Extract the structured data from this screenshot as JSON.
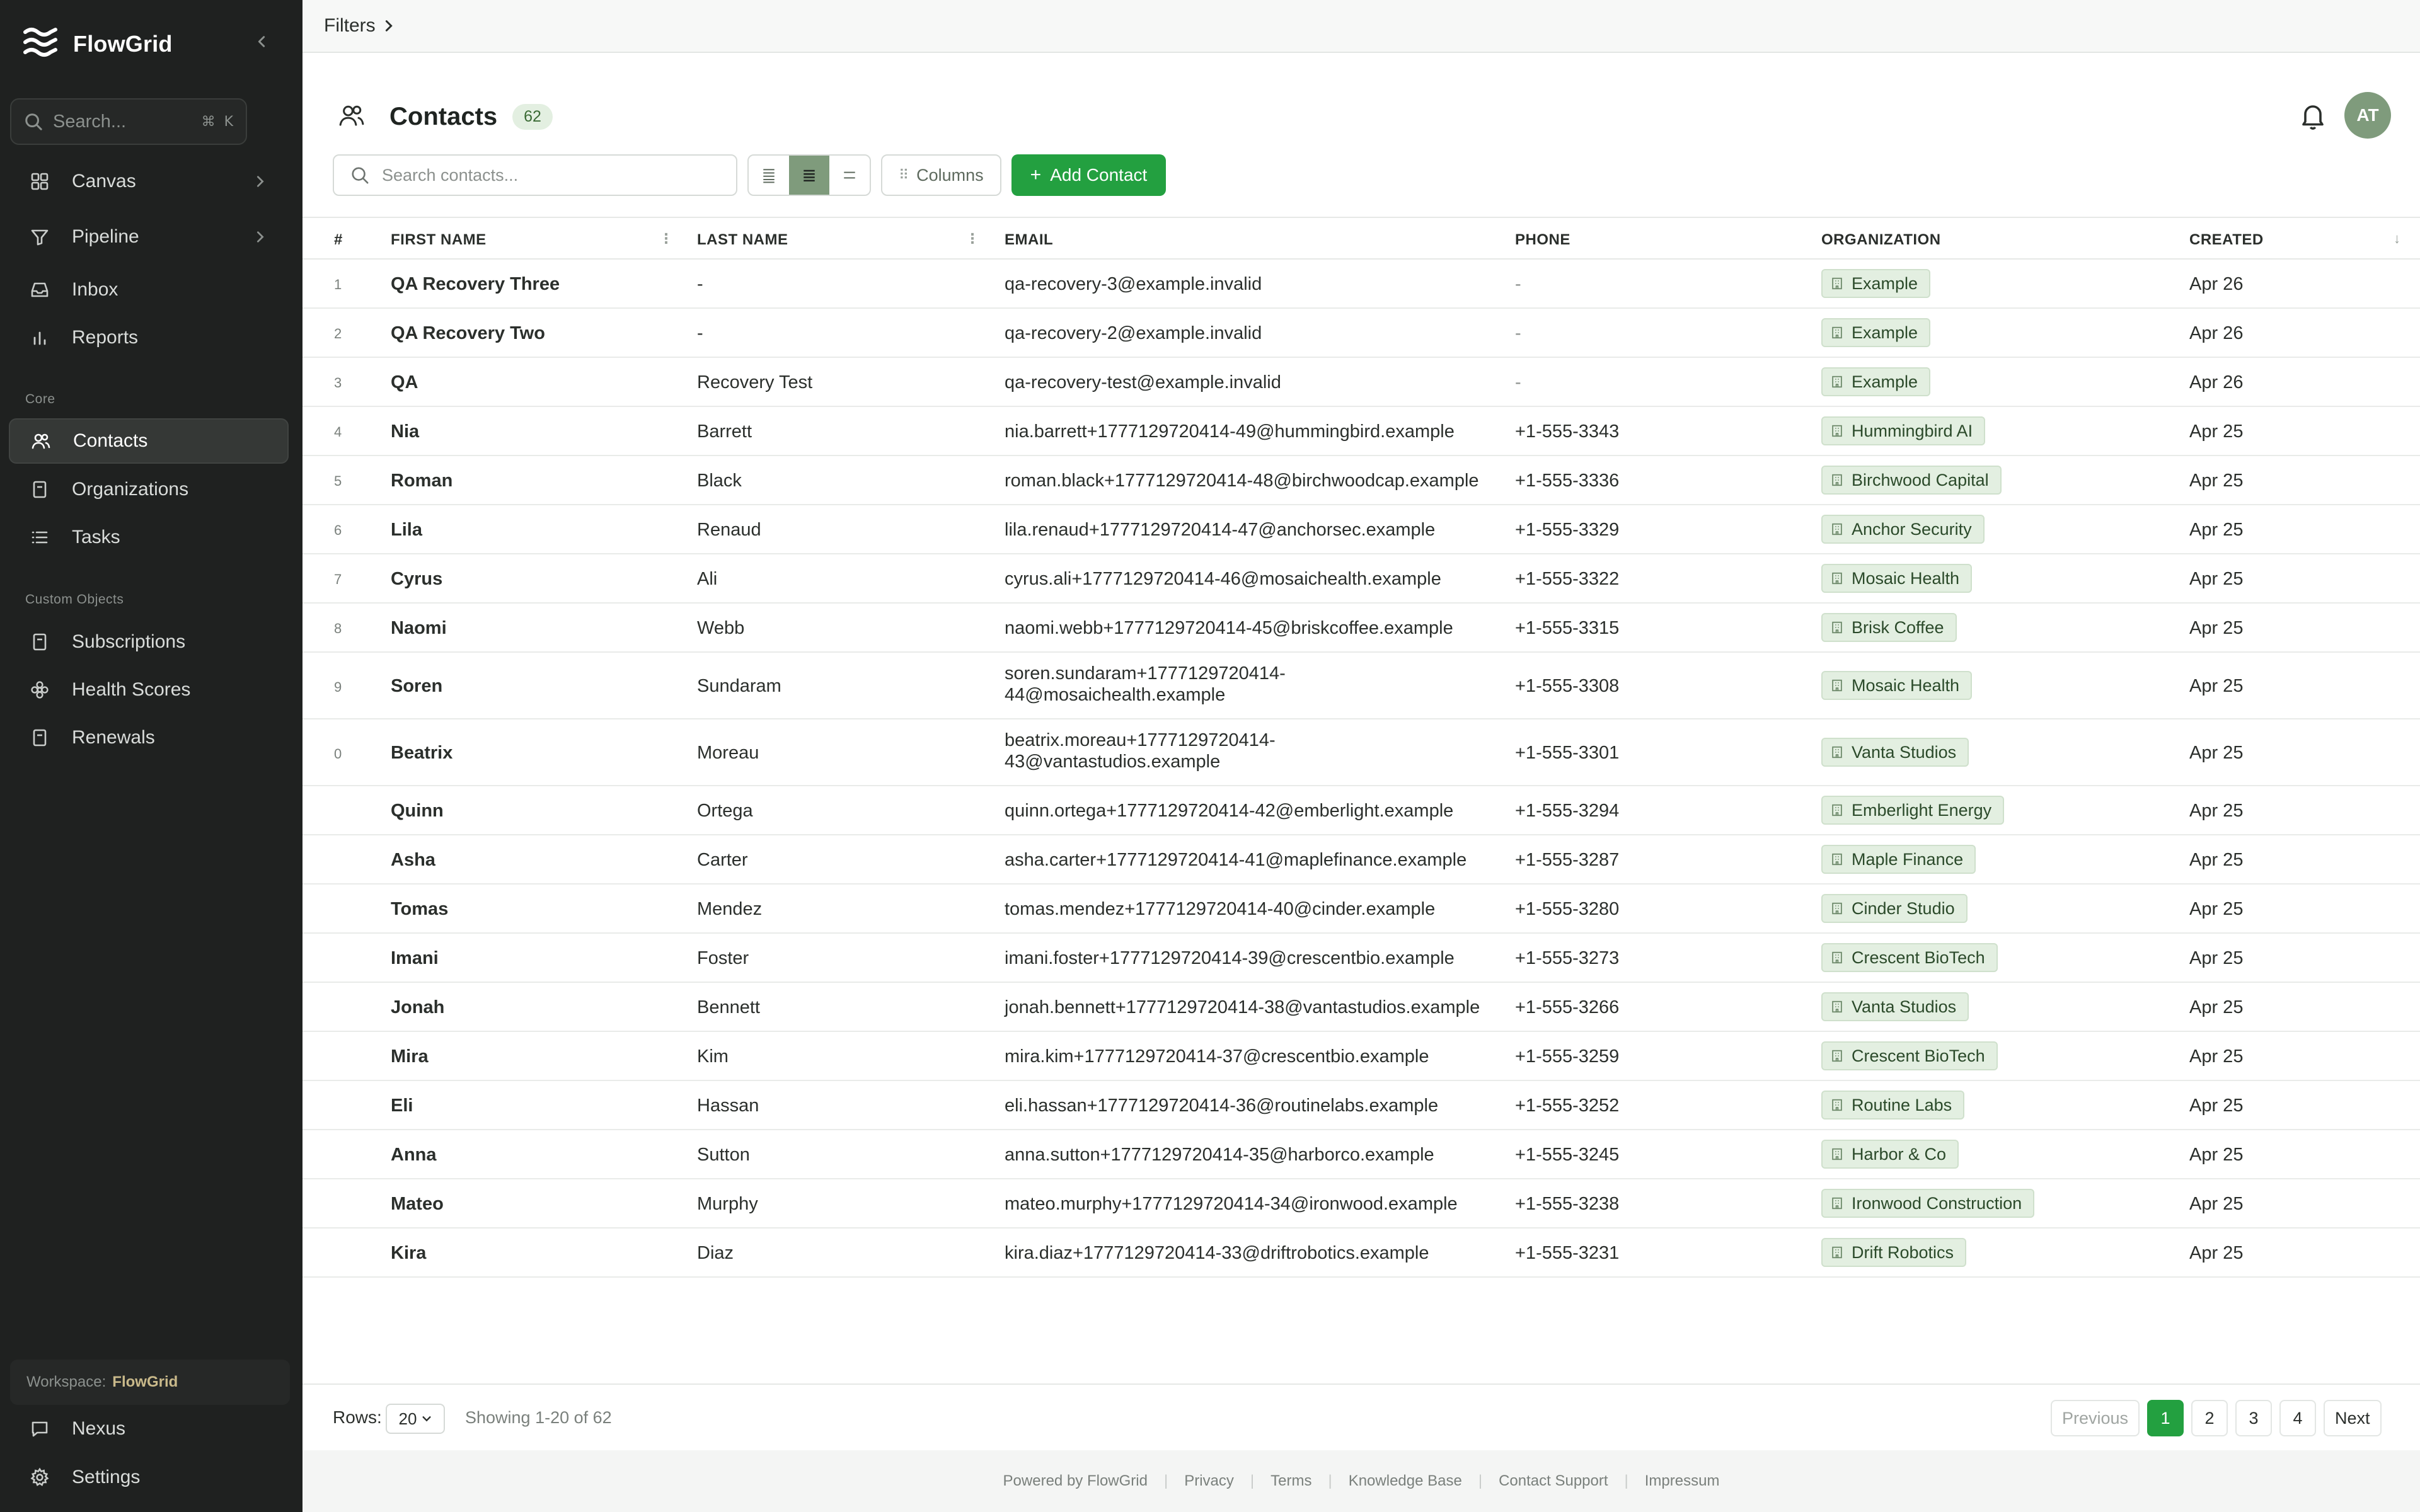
{
  "app": {
    "name": "FlowGrid"
  },
  "sidebar": {
    "search_placeholder": "Search...",
    "shortcut": [
      "⌘",
      "K"
    ],
    "top_items": [
      {
        "label": "Canvas",
        "icon": "grid-icon",
        "has_chevron": true
      },
      {
        "label": "Pipeline",
        "icon": "filter-icon",
        "has_chevron": true
      },
      {
        "label": "Inbox",
        "icon": "inbox-icon"
      },
      {
        "label": "Reports",
        "icon": "bar-chart-icon"
      }
    ],
    "core_label": "Core",
    "core_items": [
      {
        "label": "Contacts",
        "icon": "users-icon",
        "active": true
      },
      {
        "label": "Organizations",
        "icon": "document-icon"
      },
      {
        "label": "Tasks",
        "icon": "list-icon"
      }
    ],
    "custom_label": "Custom Objects",
    "custom_items": [
      {
        "label": "Subscriptions",
        "icon": "document-icon"
      },
      {
        "label": "Health Scores",
        "icon": "flower-icon"
      },
      {
        "label": "Renewals",
        "icon": "document-icon"
      }
    ],
    "workspace_label": "Workspace:",
    "workspace_name": "FlowGrid",
    "bottom_items": [
      {
        "label": "Nexus",
        "icon": "message-icon"
      },
      {
        "label": "Settings",
        "icon": "gear-icon"
      }
    ]
  },
  "filters_label": "Filters",
  "page": {
    "title": "Contacts",
    "count": "62",
    "avatar_initials": "AT",
    "search_placeholder": "Search contacts...",
    "columns_label": "Columns",
    "add_label": "Add Contact"
  },
  "table": {
    "headers": {
      "index": "#",
      "first_name": "FIRST NAME",
      "last_name": "LAST NAME",
      "email": "EMAIL",
      "phone": "PHONE",
      "organization": "ORGANIZATION",
      "created": "CREATED"
    },
    "rows": [
      {
        "index": "1",
        "first_name": "QA Recovery Three",
        "last_name": "-",
        "email": "qa-recovery-3@example.invalid",
        "phone": "-",
        "organization": "Example",
        "created": "Apr 26"
      },
      {
        "index": "2",
        "first_name": "QA Recovery Two",
        "last_name": "-",
        "email": "qa-recovery-2@example.invalid",
        "phone": "-",
        "organization": "Example",
        "created": "Apr 26"
      },
      {
        "index": "3",
        "first_name": "QA",
        "last_name": "Recovery Test",
        "email": "qa-recovery-test@example.invalid",
        "phone": "-",
        "organization": "Example",
        "created": "Apr 26"
      },
      {
        "index": "4",
        "first_name": "Nia",
        "last_name": "Barrett",
        "email": "nia.barrett+1777129720414-49@hummingbird.example",
        "phone": "+1-555-3343",
        "organization": "Hummingbird AI",
        "created": "Apr 25"
      },
      {
        "index": "5",
        "first_name": "Roman",
        "last_name": "Black",
        "email": "roman.black+1777129720414-48@birchwoodcap.example",
        "phone": "+1-555-3336",
        "organization": "Birchwood Capital",
        "created": "Apr 25"
      },
      {
        "index": "6",
        "first_name": "Lila",
        "last_name": "Renaud",
        "email": "lila.renaud+1777129720414-47@anchorsec.example",
        "phone": "+1-555-3329",
        "organization": "Anchor Security",
        "created": "Apr 25"
      },
      {
        "index": "7",
        "first_name": "Cyrus",
        "last_name": "Ali",
        "email": "cyrus.ali+1777129720414-46@mosaichealth.example",
        "phone": "+1-555-3322",
        "organization": "Mosaic Health",
        "created": "Apr 25"
      },
      {
        "index": "8",
        "first_name": "Naomi",
        "last_name": "Webb",
        "email": "naomi.webb+1777129720414-45@briskcoffee.example",
        "phone": "+1-555-3315",
        "organization": "Brisk Coffee",
        "created": "Apr 25"
      },
      {
        "index": "9",
        "first_name": "Soren",
        "last_name": "Sundaram",
        "email": "soren.sundaram+1777129720414-44@mosaichealth.example",
        "phone": "+1-555-3308",
        "organization": "Mosaic Health",
        "created": "Apr 25",
        "tall": true
      },
      {
        "index": "0",
        "first_name": "Beatrix",
        "last_name": "Moreau",
        "email": "beatrix.moreau+1777129720414-43@vantastudios.example",
        "phone": "+1-555-3301",
        "organization": "Vanta Studios",
        "created": "Apr 25",
        "tall": true
      },
      {
        "index": "",
        "first_name": "Quinn",
        "last_name": "Ortega",
        "email": "quinn.ortega+1777129720414-42@emberlight.example",
        "phone": "+1-555-3294",
        "organization": "Emberlight Energy",
        "created": "Apr 25"
      },
      {
        "index": "",
        "first_name": "Asha",
        "last_name": "Carter",
        "email": "asha.carter+1777129720414-41@maplefinance.example",
        "phone": "+1-555-3287",
        "organization": "Maple Finance",
        "created": "Apr 25"
      },
      {
        "index": "",
        "first_name": "Tomas",
        "last_name": "Mendez",
        "email": "tomas.mendez+1777129720414-40@cinder.example",
        "phone": "+1-555-3280",
        "organization": "Cinder Studio",
        "created": "Apr 25"
      },
      {
        "index": "",
        "first_name": "Imani",
        "last_name": "Foster",
        "email": "imani.foster+1777129720414-39@crescentbio.example",
        "phone": "+1-555-3273",
        "organization": "Crescent BioTech",
        "created": "Apr 25"
      },
      {
        "index": "",
        "first_name": "Jonah",
        "last_name": "Bennett",
        "email": "jonah.bennett+1777129720414-38@vantastudios.example",
        "phone": "+1-555-3266",
        "organization": "Vanta Studios",
        "created": "Apr 25"
      },
      {
        "index": "",
        "first_name": "Mira",
        "last_name": "Kim",
        "email": "mira.kim+1777129720414-37@crescentbio.example",
        "phone": "+1-555-3259",
        "organization": "Crescent BioTech",
        "created": "Apr 25"
      },
      {
        "index": "",
        "first_name": "Eli",
        "last_name": "Hassan",
        "email": "eli.hassan+1777129720414-36@routinelabs.example",
        "phone": "+1-555-3252",
        "organization": "Routine Labs",
        "created": "Apr 25"
      },
      {
        "index": "",
        "first_name": "Anna",
        "last_name": "Sutton",
        "email": "anna.sutton+1777129720414-35@harborco.example",
        "phone": "+1-555-3245",
        "organization": "Harbor & Co",
        "created": "Apr 25"
      },
      {
        "index": "",
        "first_name": "Mateo",
        "last_name": "Murphy",
        "email": "mateo.murphy+1777129720414-34@ironwood.example",
        "phone": "+1-555-3238",
        "organization": "Ironwood Construction",
        "created": "Apr 25"
      },
      {
        "index": "",
        "first_name": "Kira",
        "last_name": "Diaz",
        "email": "kira.diaz+1777129720414-33@driftrobotics.example",
        "phone": "+1-555-3231",
        "organization": "Drift Robotics",
        "created": "Apr 25"
      }
    ]
  },
  "pagination": {
    "rows_label": "Rows:",
    "rows_value": "20",
    "showing": "Showing 1-20 of 62",
    "previous": "Previous",
    "pages": [
      "1",
      "2",
      "3",
      "4"
    ],
    "current_page": "1",
    "next": "Next"
  },
  "footer_links": [
    "Powered by FlowGrid",
    "Privacy",
    "Terms",
    "Knowledge Base",
    "Contact Support",
    "Impressum"
  ],
  "colors": {
    "sidebar_bg": "#1f2120",
    "accent_green": "#23a040",
    "sage": "#7f9b7c",
    "tag_bg": "#e3efe1"
  }
}
